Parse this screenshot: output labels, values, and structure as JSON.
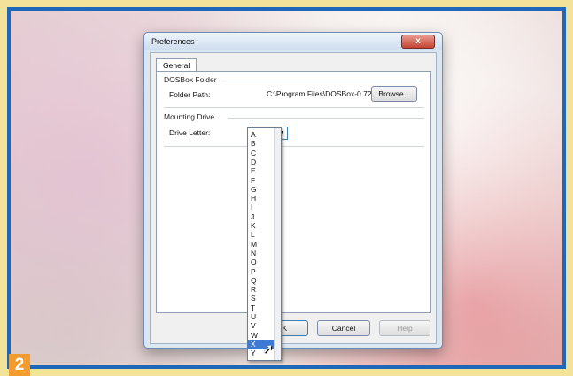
{
  "dialog": {
    "title": "Preferences",
    "close_glyph": "x",
    "tab_label": "General",
    "dosbox_group": "DOSBox Folder",
    "folder_label": "Folder Path:",
    "folder_value": "C:\\Program Files\\DOSBox-0.72",
    "browse_label": "Browse...",
    "mount_group": "Mounting Drive",
    "drive_label": "Drive Letter:",
    "drive_value": "X",
    "ok_label": "OK",
    "cancel_label": "Cancel",
    "help_label": "Help"
  },
  "dropdown": {
    "options": [
      "A",
      "B",
      "C",
      "D",
      "E",
      "F",
      "G",
      "H",
      "I",
      "J",
      "K",
      "L",
      "M",
      "N",
      "O",
      "P",
      "Q",
      "R",
      "S",
      "T",
      "U",
      "V",
      "W",
      "X",
      "Y"
    ],
    "selected": "X"
  },
  "badge": {
    "number": "2"
  },
  "colors": {
    "frame": "#1f67b8",
    "badge": "#f39b2c",
    "selection": "#3d7ad6"
  }
}
